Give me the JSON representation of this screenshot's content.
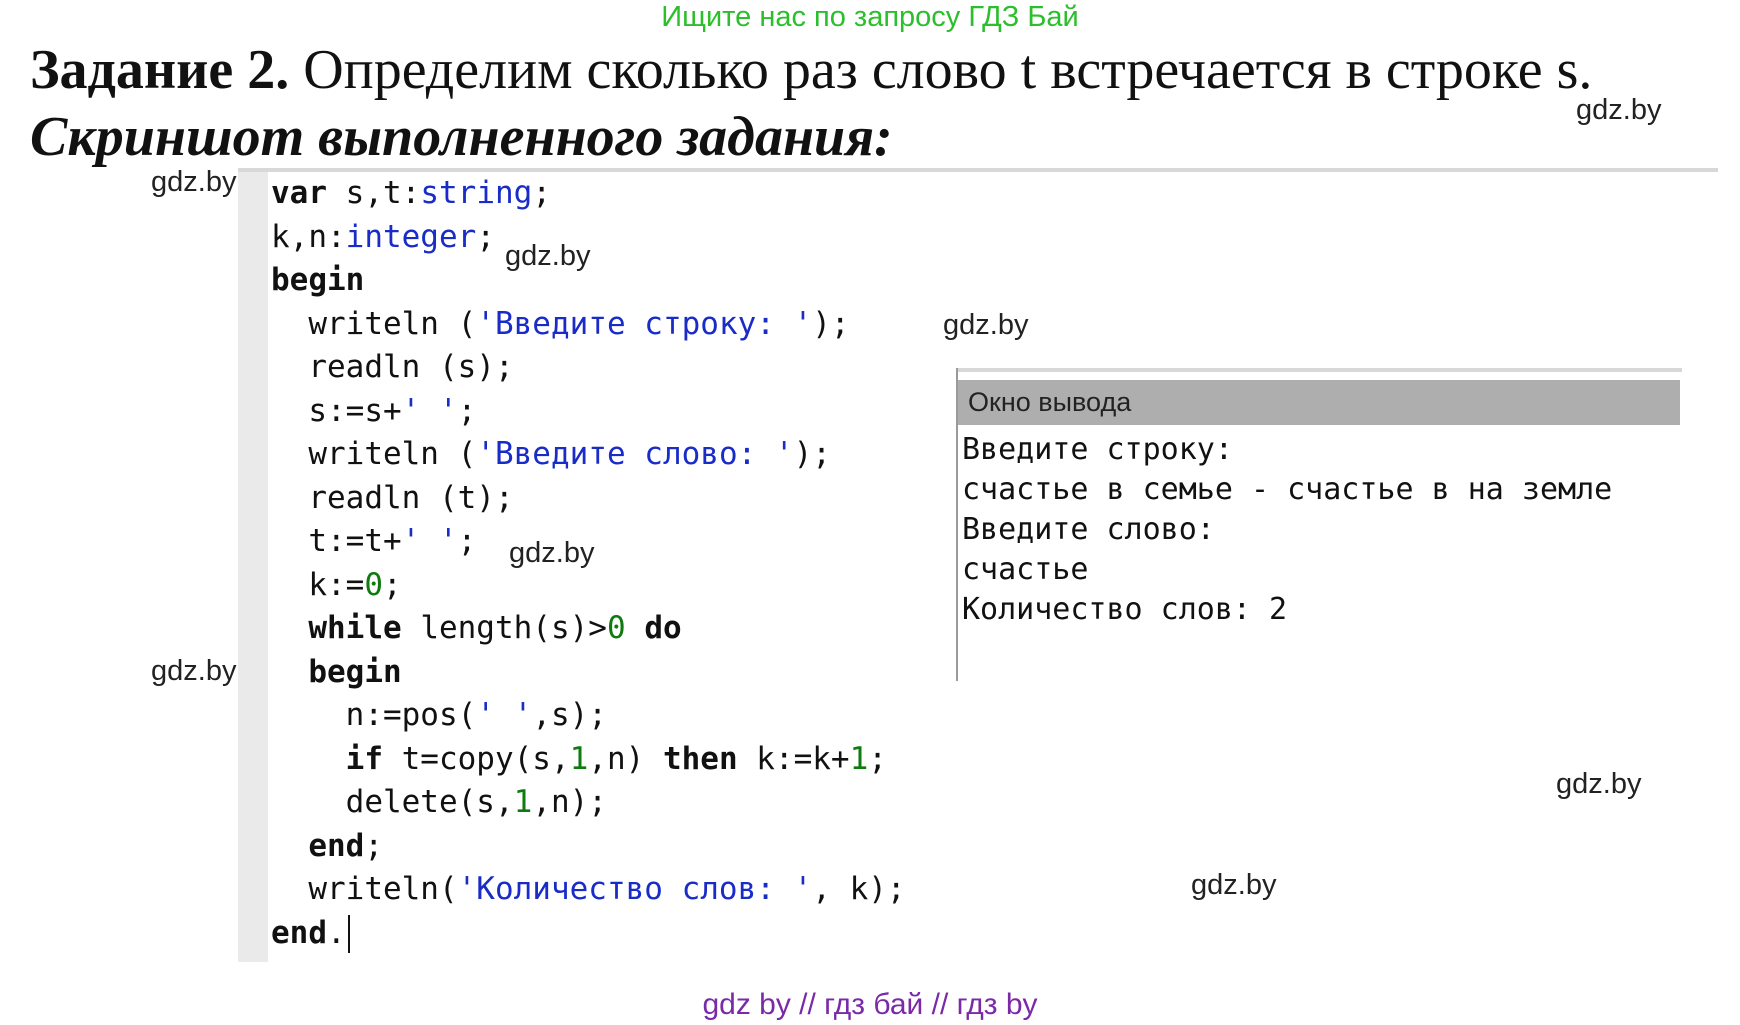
{
  "top_banner": "Ищите нас по запросу ГДЗ Бай",
  "task": {
    "label": "Задание 2.",
    "text": " Определим сколько раз слово t встречается в строке s.",
    "subtitle": "Скриншот выполненного задания:"
  },
  "watermark": "gdz.by",
  "code": {
    "lines": [
      [
        {
          "t": "var",
          "c": "kw"
        },
        {
          "t": " s,t:"
        },
        {
          "t": "string",
          "c": "ty"
        },
        {
          "t": ";"
        }
      ],
      [
        {
          "t": "k,n:"
        },
        {
          "t": "integer",
          "c": "ty"
        },
        {
          "t": ";"
        }
      ],
      [
        {
          "t": "begin",
          "c": "kw"
        }
      ],
      [
        {
          "t": "  writeln ("
        },
        {
          "t": "'Введите строку: '",
          "c": "st"
        },
        {
          "t": ");"
        }
      ],
      [
        {
          "t": "  readln (s);"
        }
      ],
      [
        {
          "t": "  s:=s+"
        },
        {
          "t": "' '",
          "c": "st"
        },
        {
          "t": ";"
        }
      ],
      [
        {
          "t": "  writeln ("
        },
        {
          "t": "'Введите слово: '",
          "c": "st"
        },
        {
          "t": ");"
        }
      ],
      [
        {
          "t": "  readln (t);"
        }
      ],
      [
        {
          "t": "  t:=t+"
        },
        {
          "t": "' '",
          "c": "st"
        },
        {
          "t": ";"
        }
      ],
      [
        {
          "t": "  k:="
        },
        {
          "t": "0",
          "c": "nm"
        },
        {
          "t": ";"
        }
      ],
      [
        {
          "t": "  "
        },
        {
          "t": "while",
          "c": "kw"
        },
        {
          "t": " length(s)>"
        },
        {
          "t": "0",
          "c": "nm"
        },
        {
          "t": " "
        },
        {
          "t": "do",
          "c": "kw"
        }
      ],
      [
        {
          "t": "  "
        },
        {
          "t": "begin",
          "c": "kw"
        }
      ],
      [
        {
          "t": "    n:=pos("
        },
        {
          "t": "' '",
          "c": "st"
        },
        {
          "t": ",s);"
        }
      ],
      [
        {
          "t": "    "
        },
        {
          "t": "if",
          "c": "kw"
        },
        {
          "t": " t=copy(s,"
        },
        {
          "t": "1",
          "c": "nm"
        },
        {
          "t": ",n) "
        },
        {
          "t": "then",
          "c": "kw"
        },
        {
          "t": " k:=k+"
        },
        {
          "t": "1",
          "c": "nm"
        },
        {
          "t": ";"
        }
      ],
      [
        {
          "t": "    delete(s,"
        },
        {
          "t": "1",
          "c": "nm"
        },
        {
          "t": ",n);"
        }
      ],
      [
        {
          "t": "  "
        },
        {
          "t": "end",
          "c": "kw"
        },
        {
          "t": ";"
        }
      ],
      [
        {
          "t": "  writeln("
        },
        {
          "t": "'Количество слов: '",
          "c": "st"
        },
        {
          "t": ", k);"
        }
      ],
      [
        {
          "t": "end",
          "c": "kw"
        },
        {
          "t": "."
        }
      ]
    ]
  },
  "output_window": {
    "title": "Окно вывода",
    "lines": [
      "Введите строку:",
      "счастье в семье - счастье в на земле",
      "Введите слово:",
      "счастье",
      "Количество слов: 2"
    ]
  },
  "footer": "gdz by  //  гдз бай  //  гдз by"
}
